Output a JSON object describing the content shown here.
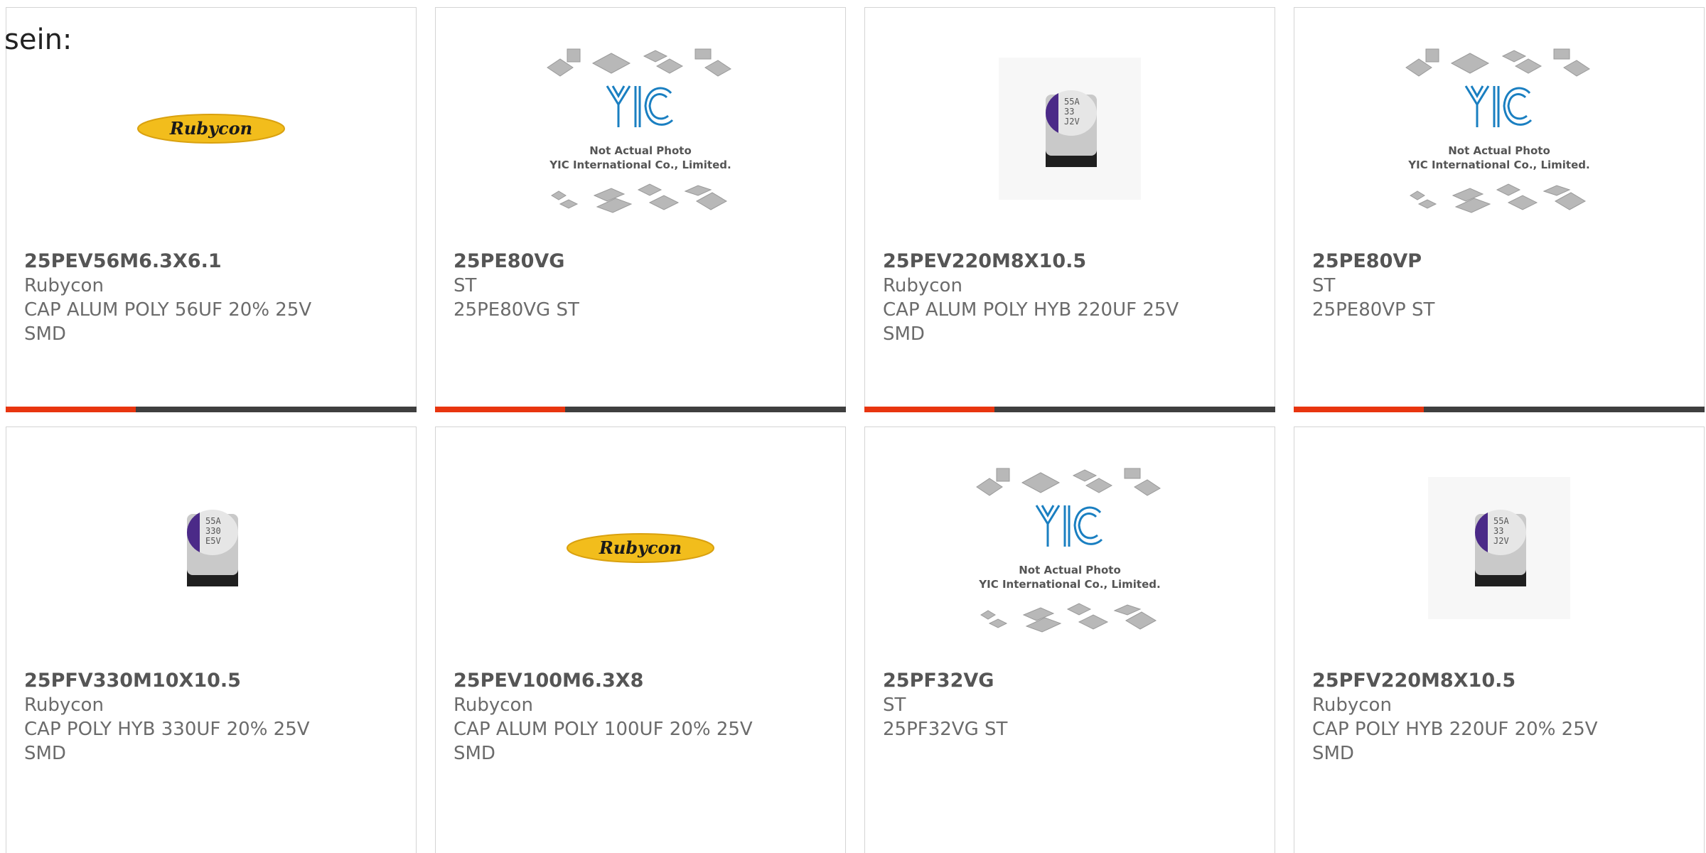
{
  "intro_text": "sein:",
  "brand_logo_text": "Rubycon",
  "yic_placeholder": {
    "logo_text": "YIC",
    "line1": "Not Actual Photo",
    "line2": "YIC International Co., Limited."
  },
  "cap_marking": {
    "a": [
      "55A",
      "33",
      "J2V"
    ],
    "b": [
      "55A",
      "330",
      "E5V"
    ],
    "c": [
      "55A",
      "33",
      "J2V"
    ]
  },
  "products": [
    {
      "part": "25PEV56M6.3X6.1",
      "brand": "Rubycon",
      "desc1": "CAP ALUM POLY 56UF 20% 25V",
      "desc2": "SMD"
    },
    {
      "part": "25PE80VG",
      "brand": "ST",
      "desc1": "25PE80VG ST",
      "desc2": ""
    },
    {
      "part": "25PEV220M8X10.5",
      "brand": "Rubycon",
      "desc1": "CAP ALUM POLY HYB 220UF 25V",
      "desc2": "SMD"
    },
    {
      "part": "25PE80VP",
      "brand": "ST",
      "desc1": "25PE80VP ST",
      "desc2": ""
    },
    {
      "part": "25PFV330M10X10.5",
      "brand": "Rubycon",
      "desc1": "CAP POLY HYB 330UF 20% 25V",
      "desc2": "SMD"
    },
    {
      "part": "25PEV100M6.3X8",
      "brand": "Rubycon",
      "desc1": "CAP ALUM POLY 100UF 20% 25V",
      "desc2": "SMD"
    },
    {
      "part": "25PF32VG",
      "brand": "ST",
      "desc1": "25PF32VG ST",
      "desc2": ""
    },
    {
      "part": "25PFV220M8X10.5",
      "brand": "Rubycon",
      "desc1": "CAP POLY HYB 220UF 20% 25V",
      "desc2": "SMD"
    }
  ],
  "colors": {
    "accent": "#e8350f",
    "bar": "#3f3f3f",
    "yic_blue": "#1a7fc1",
    "rubycon_yellow": "#f2bd1c",
    "cap_purple": "#4b2a88"
  }
}
